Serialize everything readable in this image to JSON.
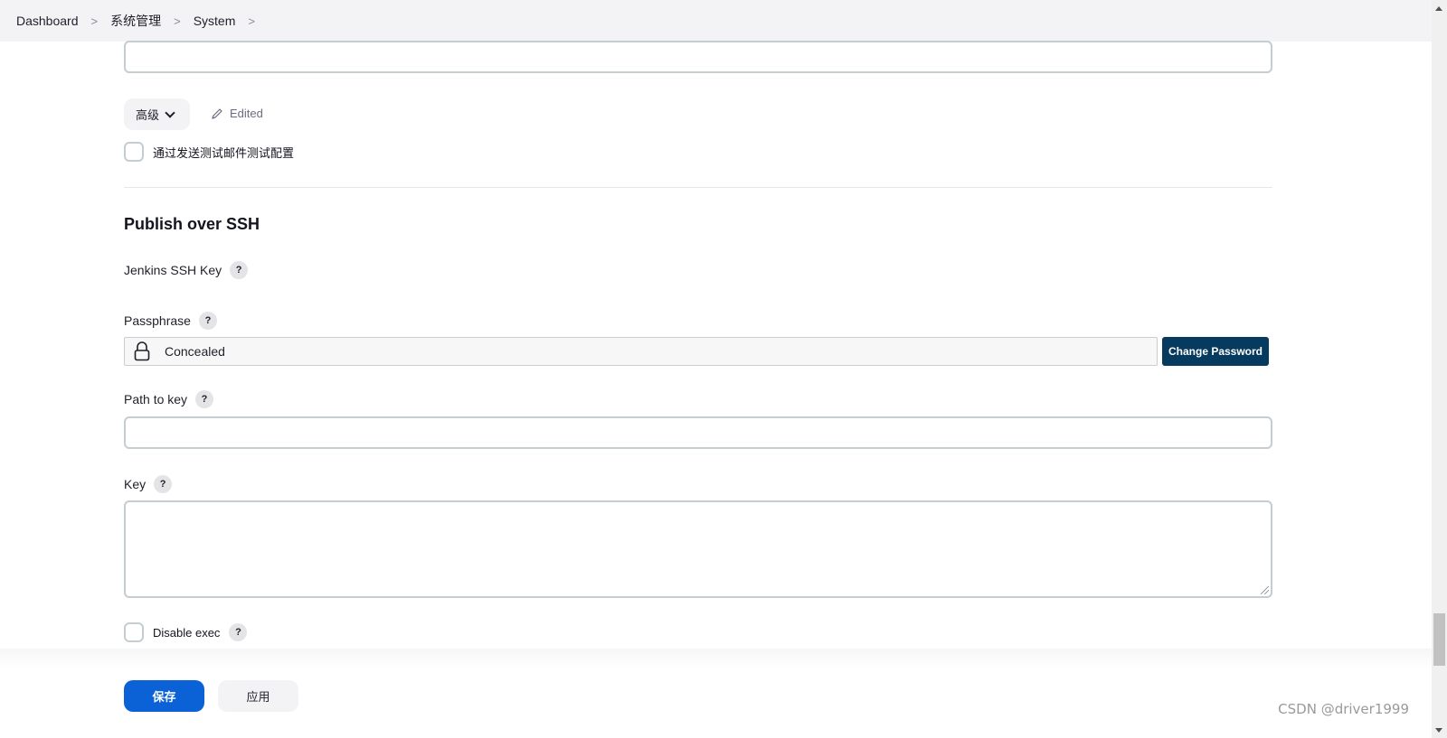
{
  "breadcrumb": {
    "items": [
      "Dashboard",
      "系统管理",
      "System"
    ],
    "separator": ">"
  },
  "email_section": {
    "advanced_label": "高级",
    "edited_label": "Edited",
    "test_config_label": "通过发送测试邮件测试配置"
  },
  "ssh_section": {
    "title": "Publish over SSH",
    "jenkins_ssh_key_label": "Jenkins SSH Key",
    "passphrase_label": "Passphrase",
    "passphrase_value": "Concealed",
    "change_password_label": "Change Password",
    "path_to_key_label": "Path to key",
    "path_to_key_value": "",
    "key_label": "Key",
    "key_value": "",
    "disable_exec_label": "Disable exec",
    "help_glyph": "?"
  },
  "footer": {
    "save_label": "保存",
    "apply_label": "应用"
  },
  "watermark": "CSDN @driver1999",
  "colors": {
    "primary": "#0b61d6",
    "change_password_bg": "#063a5e"
  }
}
